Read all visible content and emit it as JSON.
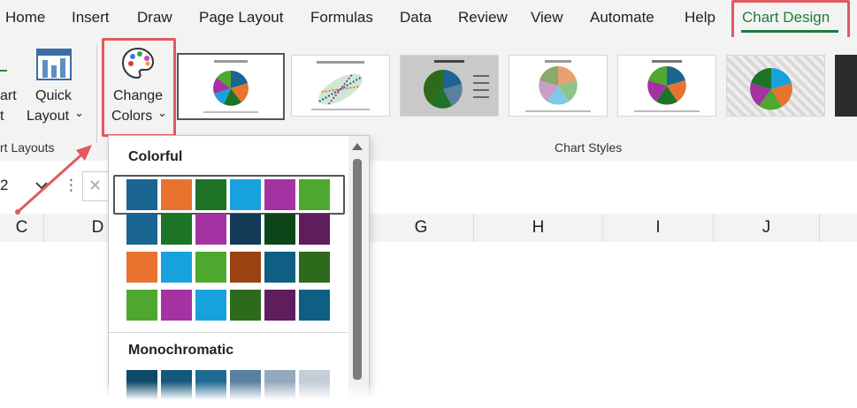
{
  "menu": {
    "items": [
      "Home",
      "Insert",
      "Draw",
      "Page Layout",
      "Formulas",
      "Data",
      "Review",
      "View",
      "Automate",
      "Help"
    ],
    "active_tab": "Chart Design"
  },
  "ribbon": {
    "add_chart_label_line1": "art",
    "add_chart_label_line2": "t",
    "quick_layout_line1": "Quick",
    "quick_layout_line2": "Layout",
    "change_colors_line1": "Change",
    "change_colors_line2": "Colors",
    "chart_layouts_group": "rt Layouts",
    "chart_styles_group": "Chart Styles",
    "chevron": "⌄"
  },
  "formula_bar": {
    "name_box": "2",
    "cancel_symbol": "✕",
    "more_symbol": "⋮"
  },
  "columns": [
    "C",
    "D",
    "G",
    "H",
    "I",
    "J"
  ],
  "dropdown": {
    "colorful_heading": "Colorful",
    "monochromatic_heading": "Monochromatic",
    "colorful_rows": [
      [
        "#1a6591",
        "#e8732f",
        "#1d7326",
        "#17a2de",
        "#a333a2",
        "#4ea82f"
      ],
      [
        "#1a6591",
        "#1d7326",
        "#a333a2",
        "#123a57",
        "#0f4619",
        "#5f1d5e"
      ],
      [
        "#e8732f",
        "#17a2de",
        "#4ea82f",
        "#9a4212",
        "#0f5f84",
        "#2e6a1c"
      ],
      [
        "#4ea82f",
        "#a333a2",
        "#17a2de",
        "#2e6a1c",
        "#5f1d5e",
        "#0f5f84"
      ]
    ],
    "mono_rows": [
      [
        "#0e4a6a",
        "#14587c",
        "#1f6a92",
        "#5a80a0",
        "#95a9bd",
        "#c3ced9"
      ]
    ]
  },
  "colors": {
    "accent_green": "#1e7b3c",
    "highlight_red": "#e05a5f"
  },
  "style_thumbnails": [
    {
      "style": "pie-white-selected"
    },
    {
      "style": "pie-hatched-title"
    },
    {
      "style": "pie-gray-gradient"
    },
    {
      "style": "pie-muted-legend"
    },
    {
      "style": "pie-white"
    },
    {
      "style": "pie-striped"
    },
    {
      "style": "dark"
    }
  ]
}
